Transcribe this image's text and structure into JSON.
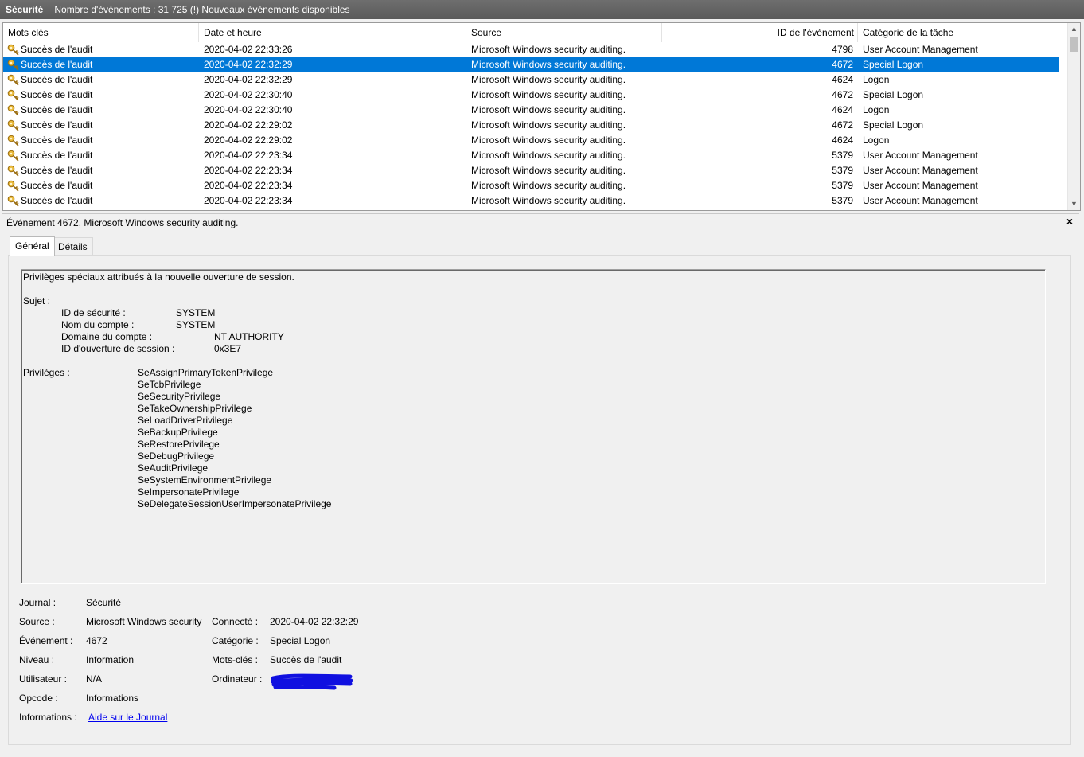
{
  "titlebar": {
    "name": "Sécurité",
    "info": "Nombre d'événements : 31 725 (!) Nouveaux événements disponibles"
  },
  "columns": [
    "Mots clés",
    "Date et heure",
    "Source",
    "ID de l'événement",
    "Catégorie de la tâche"
  ],
  "events": [
    {
      "keyword": "Succès de l'audit",
      "date": "2020-04-02 22:33:26",
      "source": "Microsoft Windows security auditing.",
      "id": "4798",
      "category": "User Account Management"
    },
    {
      "keyword": "Succès de l'audit",
      "date": "2020-04-02 22:32:29",
      "source": "Microsoft Windows security auditing.",
      "id": "4672",
      "category": "Special Logon",
      "selected": true
    },
    {
      "keyword": "Succès de l'audit",
      "date": "2020-04-02 22:32:29",
      "source": "Microsoft Windows security auditing.",
      "id": "4624",
      "category": "Logon"
    },
    {
      "keyword": "Succès de l'audit",
      "date": "2020-04-02 22:30:40",
      "source": "Microsoft Windows security auditing.",
      "id": "4672",
      "category": "Special Logon"
    },
    {
      "keyword": "Succès de l'audit",
      "date": "2020-04-02 22:30:40",
      "source": "Microsoft Windows security auditing.",
      "id": "4624",
      "category": "Logon"
    },
    {
      "keyword": "Succès de l'audit",
      "date": "2020-04-02 22:29:02",
      "source": "Microsoft Windows security auditing.",
      "id": "4672",
      "category": "Special Logon"
    },
    {
      "keyword": "Succès de l'audit",
      "date": "2020-04-02 22:29:02",
      "source": "Microsoft Windows security auditing.",
      "id": "4624",
      "category": "Logon"
    },
    {
      "keyword": "Succès de l'audit",
      "date": "2020-04-02 22:23:34",
      "source": "Microsoft Windows security auditing.",
      "id": "5379",
      "category": "User Account Management"
    },
    {
      "keyword": "Succès de l'audit",
      "date": "2020-04-02 22:23:34",
      "source": "Microsoft Windows security auditing.",
      "id": "5379",
      "category": "User Account Management"
    },
    {
      "keyword": "Succès de l'audit",
      "date": "2020-04-02 22:23:34",
      "source": "Microsoft Windows security auditing.",
      "id": "5379",
      "category": "User Account Management"
    },
    {
      "keyword": "Succès de l'audit",
      "date": "2020-04-02 22:23:34",
      "source": "Microsoft Windows security auditing.",
      "id": "5379",
      "category": "User Account Management"
    }
  ],
  "detail": {
    "title": "Événement 4672, Microsoft Windows security auditing.",
    "close_glyph": "×",
    "tabs": [
      "Général",
      "Détails"
    ],
    "active_tab": 0
  },
  "description": {
    "heading": "Privilèges spéciaux attribués à la nouvelle ouverture de session.",
    "subject_label": "Sujet :",
    "subject_fields": [
      {
        "label": "ID de sécurité :",
        "value": "SYSTEM"
      },
      {
        "label": "Nom du compte :",
        "value": "SYSTEM"
      },
      {
        "label": "Domaine du compte :",
        "value": "NT AUTHORITY"
      },
      {
        "label": "ID d'ouverture de session :",
        "value": "0x3E7"
      }
    ],
    "privileges_label": "Privilèges :",
    "privileges": [
      "SeAssignPrimaryTokenPrivilege",
      "SeTcbPrivilege",
      "SeSecurityPrivilege",
      "SeTakeOwnershipPrivilege",
      "SeLoadDriverPrivilege",
      "SeBackupPrivilege",
      "SeRestorePrivilege",
      "SeDebugPrivilege",
      "SeAuditPrivilege",
      "SeSystemEnvironmentPrivilege",
      "SeImpersonatePrivilege",
      "SeDelegateSessionUserImpersonatePrivilege"
    ]
  },
  "properties": {
    "journal_label": "Journal :",
    "journal": "Sécurité",
    "source_label": "Source :",
    "source": "Microsoft Windows security",
    "logged_label": "Connecté :",
    "logged": "2020-04-02 22:32:29",
    "event_label": "Événement :",
    "event": "4672",
    "category_label": "Catégorie :",
    "category": "Special Logon",
    "level_label": "Niveau :",
    "level": "Information",
    "keywords_label": "Mots-clés :",
    "keywords": "Succès de l'audit",
    "user_label": "Utilisateur :",
    "user": "N/A",
    "computer_label": "Ordinateur :",
    "opcode_label": "Opcode :",
    "opcode": "Informations",
    "info_label": "Informations :",
    "info_link": "Aide sur le Journal"
  },
  "colors": {
    "selection": "#0078d7",
    "titlebar": "#606060",
    "link": "#0000ee",
    "redaction": "#1010e0"
  }
}
